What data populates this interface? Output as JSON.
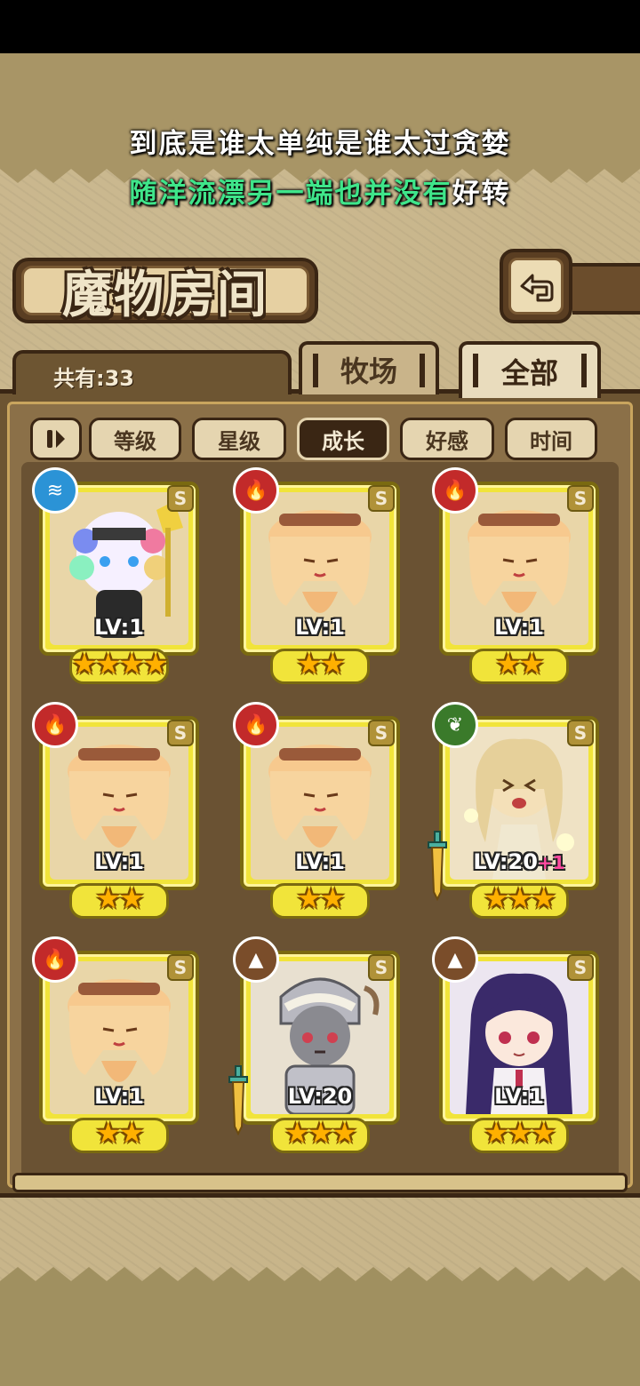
{
  "lyrics": {
    "line1": "到底是谁太单纯是谁太过贪婪",
    "line2_green": "随洋流漂另一端也并没有",
    "line2_white": "好转"
  },
  "header": {
    "title": "魔物房间",
    "back_icon": "back-arrow-icon"
  },
  "summary": {
    "count_label": "共有:33"
  },
  "tabs": [
    {
      "label": "牧场",
      "active": false
    },
    {
      "label": "全部",
      "active": true
    }
  ],
  "filters": {
    "toggle_icon": "sort-toggle-icon",
    "options": [
      {
        "label": "等级",
        "active": false
      },
      {
        "label": "星级",
        "active": false
      },
      {
        "label": "成长",
        "active": true
      },
      {
        "label": "好感",
        "active": false
      },
      {
        "label": "时间",
        "active": false
      }
    ]
  },
  "monsters": [
    {
      "element": "water",
      "element_icon": "water-element-icon",
      "rank": "S",
      "level": "LV:1",
      "plus": "",
      "stars": "★★★★",
      "art": "tribal-girl",
      "weapon": false
    },
    {
      "element": "fire",
      "element_icon": "fire-element-icon",
      "rank": "S",
      "level": "LV:1",
      "plus": "",
      "stars": "★★",
      "art": "pudding",
      "weapon": false
    },
    {
      "element": "fire",
      "element_icon": "fire-element-icon",
      "rank": "S",
      "level": "LV:1",
      "plus": "",
      "stars": "★★",
      "art": "pudding",
      "weapon": false
    },
    {
      "element": "fire",
      "element_icon": "fire-element-icon",
      "rank": "S",
      "level": "LV:1",
      "plus": "",
      "stars": "★★",
      "art": "pudding",
      "weapon": false
    },
    {
      "element": "fire",
      "element_icon": "fire-element-icon",
      "rank": "S",
      "level": "LV:1",
      "plus": "",
      "stars": "★★",
      "art": "pudding",
      "weapon": false
    },
    {
      "element": "wood",
      "element_icon": "wood-element-icon",
      "rank": "S",
      "level": "LV:20",
      "plus": "+1",
      "stars": "★★★",
      "art": "blonde-girl",
      "weapon": true
    },
    {
      "element": "fire",
      "element_icon": "fire-element-icon",
      "rank": "S",
      "level": "LV:1",
      "plus": "",
      "stars": "★★",
      "art": "pudding",
      "weapon": false
    },
    {
      "element": "earth",
      "element_icon": "earth-element-icon",
      "rank": "S",
      "level": "LV:20",
      "plus": "",
      "stars": "★★★",
      "art": "armored-girl",
      "weapon": true
    },
    {
      "element": "earth",
      "element_icon": "earth-element-icon",
      "rank": "S",
      "level": "LV:1",
      "plus": "",
      "stars": "★★★",
      "art": "purple-hair-girl",
      "weapon": false
    }
  ],
  "colors": {
    "frame_gold": "#f1e43a",
    "panel_brown": "#6d5532",
    "lyric_green": "#3fe58a",
    "fire": "#c22a2a",
    "water": "#2b93d6",
    "wood": "#3a7a2a",
    "earth": "#7a4d2a"
  }
}
